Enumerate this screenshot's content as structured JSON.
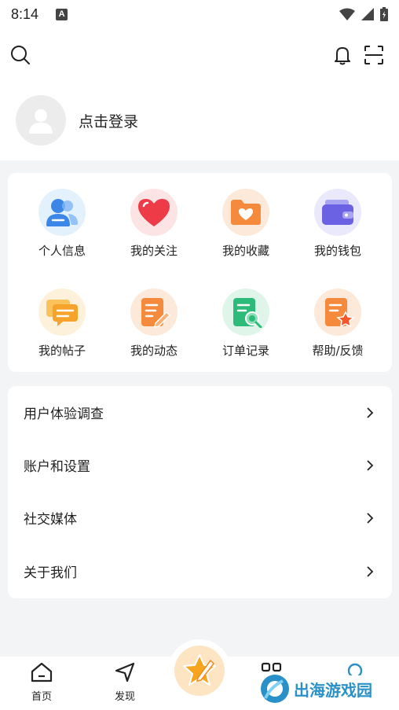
{
  "status_bar": {
    "time": "8:14",
    "notif_badge": "A"
  },
  "header": {
    "search_icon": "search-icon",
    "bell_icon": "bell-icon",
    "scan_icon": "scan-icon",
    "login_text": "点击登录"
  },
  "grid": {
    "items": [
      {
        "label": "个人信息",
        "icon": "user-icon",
        "bg": "#e3f1fd"
      },
      {
        "label": "我的关注",
        "icon": "heart-icon",
        "bg": "#fde4e4"
      },
      {
        "label": "我的收藏",
        "icon": "folder-heart-icon",
        "bg": "#fde9d9"
      },
      {
        "label": "我的钱包",
        "icon": "wallet-icon",
        "bg": "#e9e9fb"
      },
      {
        "label": "我的帖子",
        "icon": "chat-icon",
        "bg": "#fdf1dc"
      },
      {
        "label": "我的动态",
        "icon": "note-edit-icon",
        "bg": "#fde9d9"
      },
      {
        "label": "订单记录",
        "icon": "order-search-icon",
        "bg": "#dff5ea"
      },
      {
        "label": "帮助/反馈",
        "icon": "doc-star-icon",
        "bg": "#fde9d9"
      }
    ]
  },
  "list": {
    "items": [
      {
        "label": "用户体验调查"
      },
      {
        "label": "账户和设置"
      },
      {
        "label": "社交媒体"
      },
      {
        "label": "关于我们"
      }
    ]
  },
  "bottom_nav": {
    "home_label": "首页",
    "discover_label": "发现"
  },
  "watermark": {
    "text": "出海游戏园"
  }
}
